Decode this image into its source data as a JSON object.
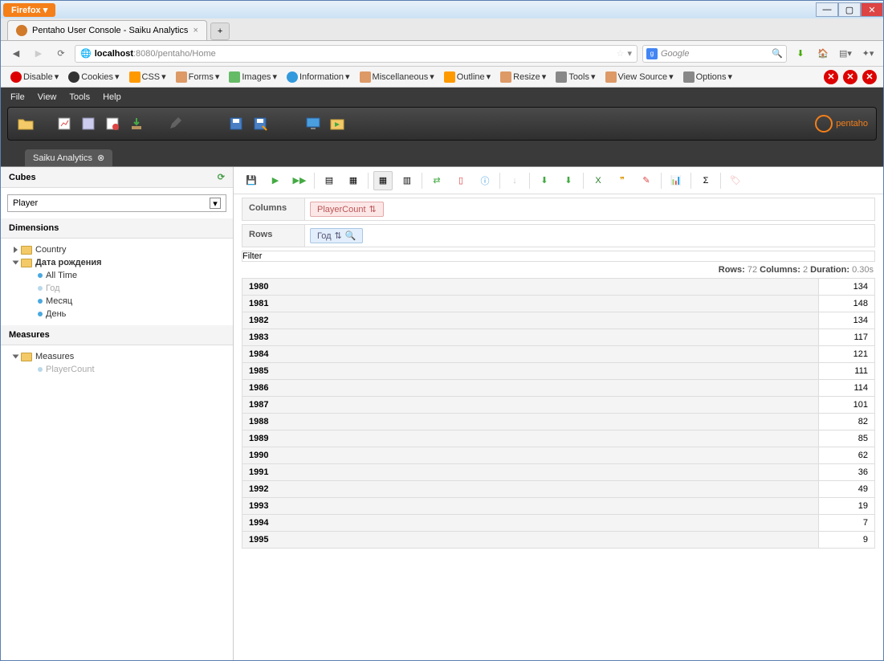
{
  "browser": {
    "firefox_label": "Firefox",
    "tab_title": "Pentaho User Console - Saiku Analytics",
    "url_host": "localhost",
    "url_path": ":8080/pentaho/Home",
    "search_placeholder": "Google"
  },
  "devtools": [
    "Disable",
    "Cookies",
    "CSS",
    "Forms",
    "Images",
    "Information",
    "Miscellaneous",
    "Outline",
    "Resize",
    "Tools",
    "View Source",
    "Options"
  ],
  "pentaho": {
    "menu": [
      "File",
      "View",
      "Tools",
      "Help"
    ],
    "logo": "pentaho",
    "tab": "Saiku Analytics"
  },
  "sidebar": {
    "cubes_title": "Cubes",
    "cube_selected": "Player",
    "dimensions_title": "Dimensions",
    "dim_country": "Country",
    "dim_birth": "Дата рождения",
    "levels": {
      "all_time": "All Time",
      "year": "Год",
      "month": "Месяц",
      "day": "День"
    },
    "measures_title": "Measures",
    "measures_folder": "Measures",
    "measure_player_count": "PlayerCount"
  },
  "axes": {
    "columns_label": "Columns",
    "columns_chip": "PlayerCount",
    "rows_label": "Rows",
    "rows_chip": "Год",
    "filter_label": "Filter"
  },
  "status": {
    "rows_label": "Rows:",
    "rows": 72,
    "cols_label": "Columns:",
    "cols": 2,
    "dur_label": "Duration:",
    "dur": "0.30s"
  },
  "chart_data": {
    "type": "table",
    "columns": [
      "Год",
      "PlayerCount"
    ],
    "rows": [
      [
        "1980",
        134
      ],
      [
        "1981",
        148
      ],
      [
        "1982",
        134
      ],
      [
        "1983",
        117
      ],
      [
        "1984",
        121
      ],
      [
        "1985",
        111
      ],
      [
        "1986",
        114
      ],
      [
        "1987",
        101
      ],
      [
        "1988",
        82
      ],
      [
        "1989",
        85
      ],
      [
        "1990",
        62
      ],
      [
        "1991",
        36
      ],
      [
        "1992",
        49
      ],
      [
        "1993",
        19
      ],
      [
        "1994",
        7
      ],
      [
        "1995",
        9
      ]
    ]
  }
}
